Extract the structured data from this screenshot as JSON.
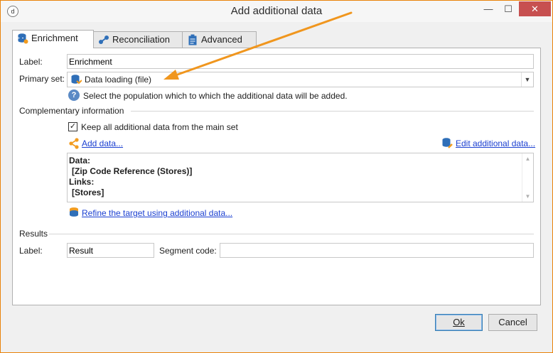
{
  "window": {
    "title": "Add additional data",
    "app_icon_glyph": "d",
    "controls": {
      "minimize": "—",
      "maximize": "☐",
      "close": "✕"
    }
  },
  "tabs": [
    {
      "label": "Enrichment",
      "icon": "database-star-icon",
      "active": true
    },
    {
      "label": "Reconciliation",
      "icon": "link-nodes-icon",
      "active": false
    },
    {
      "label": "Advanced",
      "icon": "clipboard-icon",
      "active": false
    }
  ],
  "form": {
    "label_caption": "Label:",
    "label_value": "Enrichment",
    "primary_set_caption": "Primary set:",
    "primary_set_value": "Data loading (file)",
    "primary_set_icon": "data-loading-icon",
    "help_text": "Select the population which to which the additional data will be added."
  },
  "complementary": {
    "section_title": "Complementary information",
    "keep_all_label": "Keep all additional data from the main set",
    "keep_all_checked": true,
    "add_data_link": "Add data...",
    "edit_data_link": "Edit additional data...",
    "summary_lines": [
      "Data:",
      "[Zip Code Reference (Stores)]",
      "Links:",
      "[Stores]"
    ],
    "refine_link": "Refine the target using additional data..."
  },
  "results": {
    "section_title": "Results",
    "label_caption": "Label:",
    "label_value": "Result",
    "segment_caption": "Segment code:",
    "segment_value": ""
  },
  "buttons": {
    "ok": "Ok",
    "cancel": "Cancel"
  },
  "colors": {
    "accent_border": "#e9830a",
    "annotation_arrow": "#f0961e",
    "link": "#1a3fd1",
    "close_button": "#c75050"
  }
}
